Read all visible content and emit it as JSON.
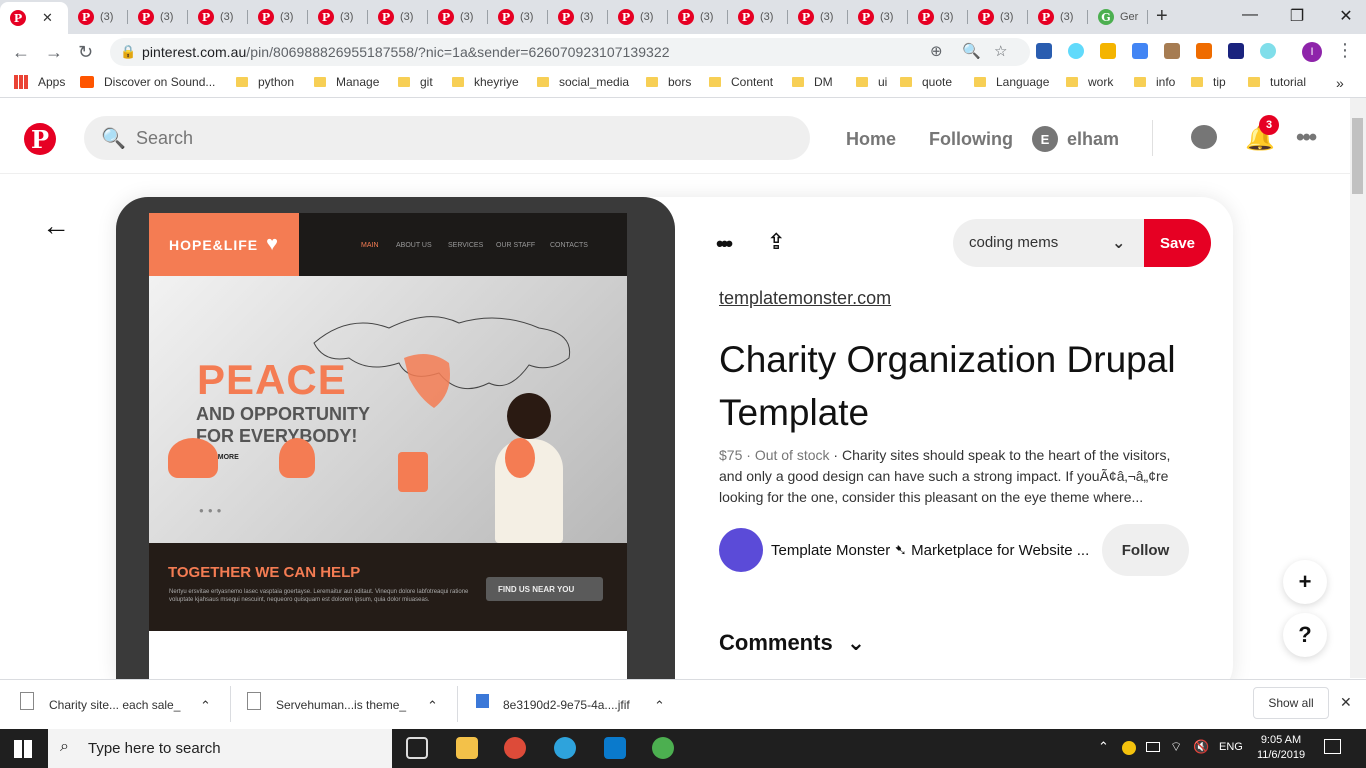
{
  "browser": {
    "tabs": [
      {
        "label": ""
      },
      {
        "label": "(3)"
      },
      {
        "label": "(3)"
      },
      {
        "label": "(3)"
      },
      {
        "label": "(3)"
      },
      {
        "label": "(3)"
      },
      {
        "label": "(3)"
      },
      {
        "label": "(3)"
      },
      {
        "label": "(3)"
      },
      {
        "label": "(3)"
      },
      {
        "label": "(3)"
      },
      {
        "label": "(3)"
      },
      {
        "label": "(3)"
      },
      {
        "label": "(3)"
      },
      {
        "label": "(3)"
      },
      {
        "label": "(3)"
      },
      {
        "label": "(3)"
      },
      {
        "label": "(3)"
      },
      {
        "label": "Ger"
      }
    ],
    "url_domain": "pinterest.com.au",
    "url_path": "/pin/806988826955187558/?nic=1a&sender=626070923107139322",
    "profile_initial": "I",
    "bookmarks": [
      "Apps",
      "Discover on Sound...",
      "python",
      "Manage",
      "git",
      "kheyriye",
      "social_media",
      "bors",
      "Content",
      "DM",
      "ui",
      "quote",
      "Language",
      "work",
      "info",
      "tip",
      "tutorial"
    ],
    "more_bookmarks": "»"
  },
  "pinterest": {
    "search_placeholder": "Search",
    "nav_home": "Home",
    "nav_following": "Following",
    "user_initial": "E",
    "user_name": "elham",
    "notifications_count": "3"
  },
  "pin": {
    "board_name": "coding mems",
    "save_label": "Save",
    "source": "templatemonster.com",
    "title": "Charity Organization Drupal Template",
    "price": "$75",
    "stock": "Out of stock",
    "description": "Charity sites should speak to the heart of the visitors, and only a good design can have such a strong impact. If youÃ¢â‚¬â„¢re looking for the one, consider this pleasant on the eye theme where...",
    "author": "Template Monster ➷ Marketplace for Website ...",
    "follow_label": "Follow",
    "comments_label": "Comments"
  },
  "preview_image": {
    "logo": "HOPE&LIFE",
    "menu": [
      "MAIN",
      "ABOUT US",
      "SERVICES",
      "OUR STAFF",
      "CONTACTS"
    ],
    "headline": "PEACE",
    "subline1": "AND OPPORTUNITY",
    "subline2": "FOR EVERYBODY!",
    "read_more": "READ MORE",
    "help_title": "TOGETHER WE CAN HELP",
    "help_text": "Nertyu ersvitae ertyasnemo lasec vasptaia goertayse. Leremaitur aut oditaut. Vinequn dolore labfotreaqui ratione voluptate kjahsaus msequi nescuint, nequeoro quisquam est dolorem ipsum, quia dolor miuaseas.",
    "find_us": "FIND US NEAR YOU"
  },
  "downloads": {
    "items": [
      "Charity site... each sale_",
      "Servehuman...is theme_",
      "8e3190d2-9e75-4a....jfif"
    ],
    "show_all": "Show all"
  },
  "taskbar": {
    "search_placeholder": "Type here to search",
    "time": "9:05 AM",
    "date": "11/6/2019",
    "language": "ENG"
  }
}
